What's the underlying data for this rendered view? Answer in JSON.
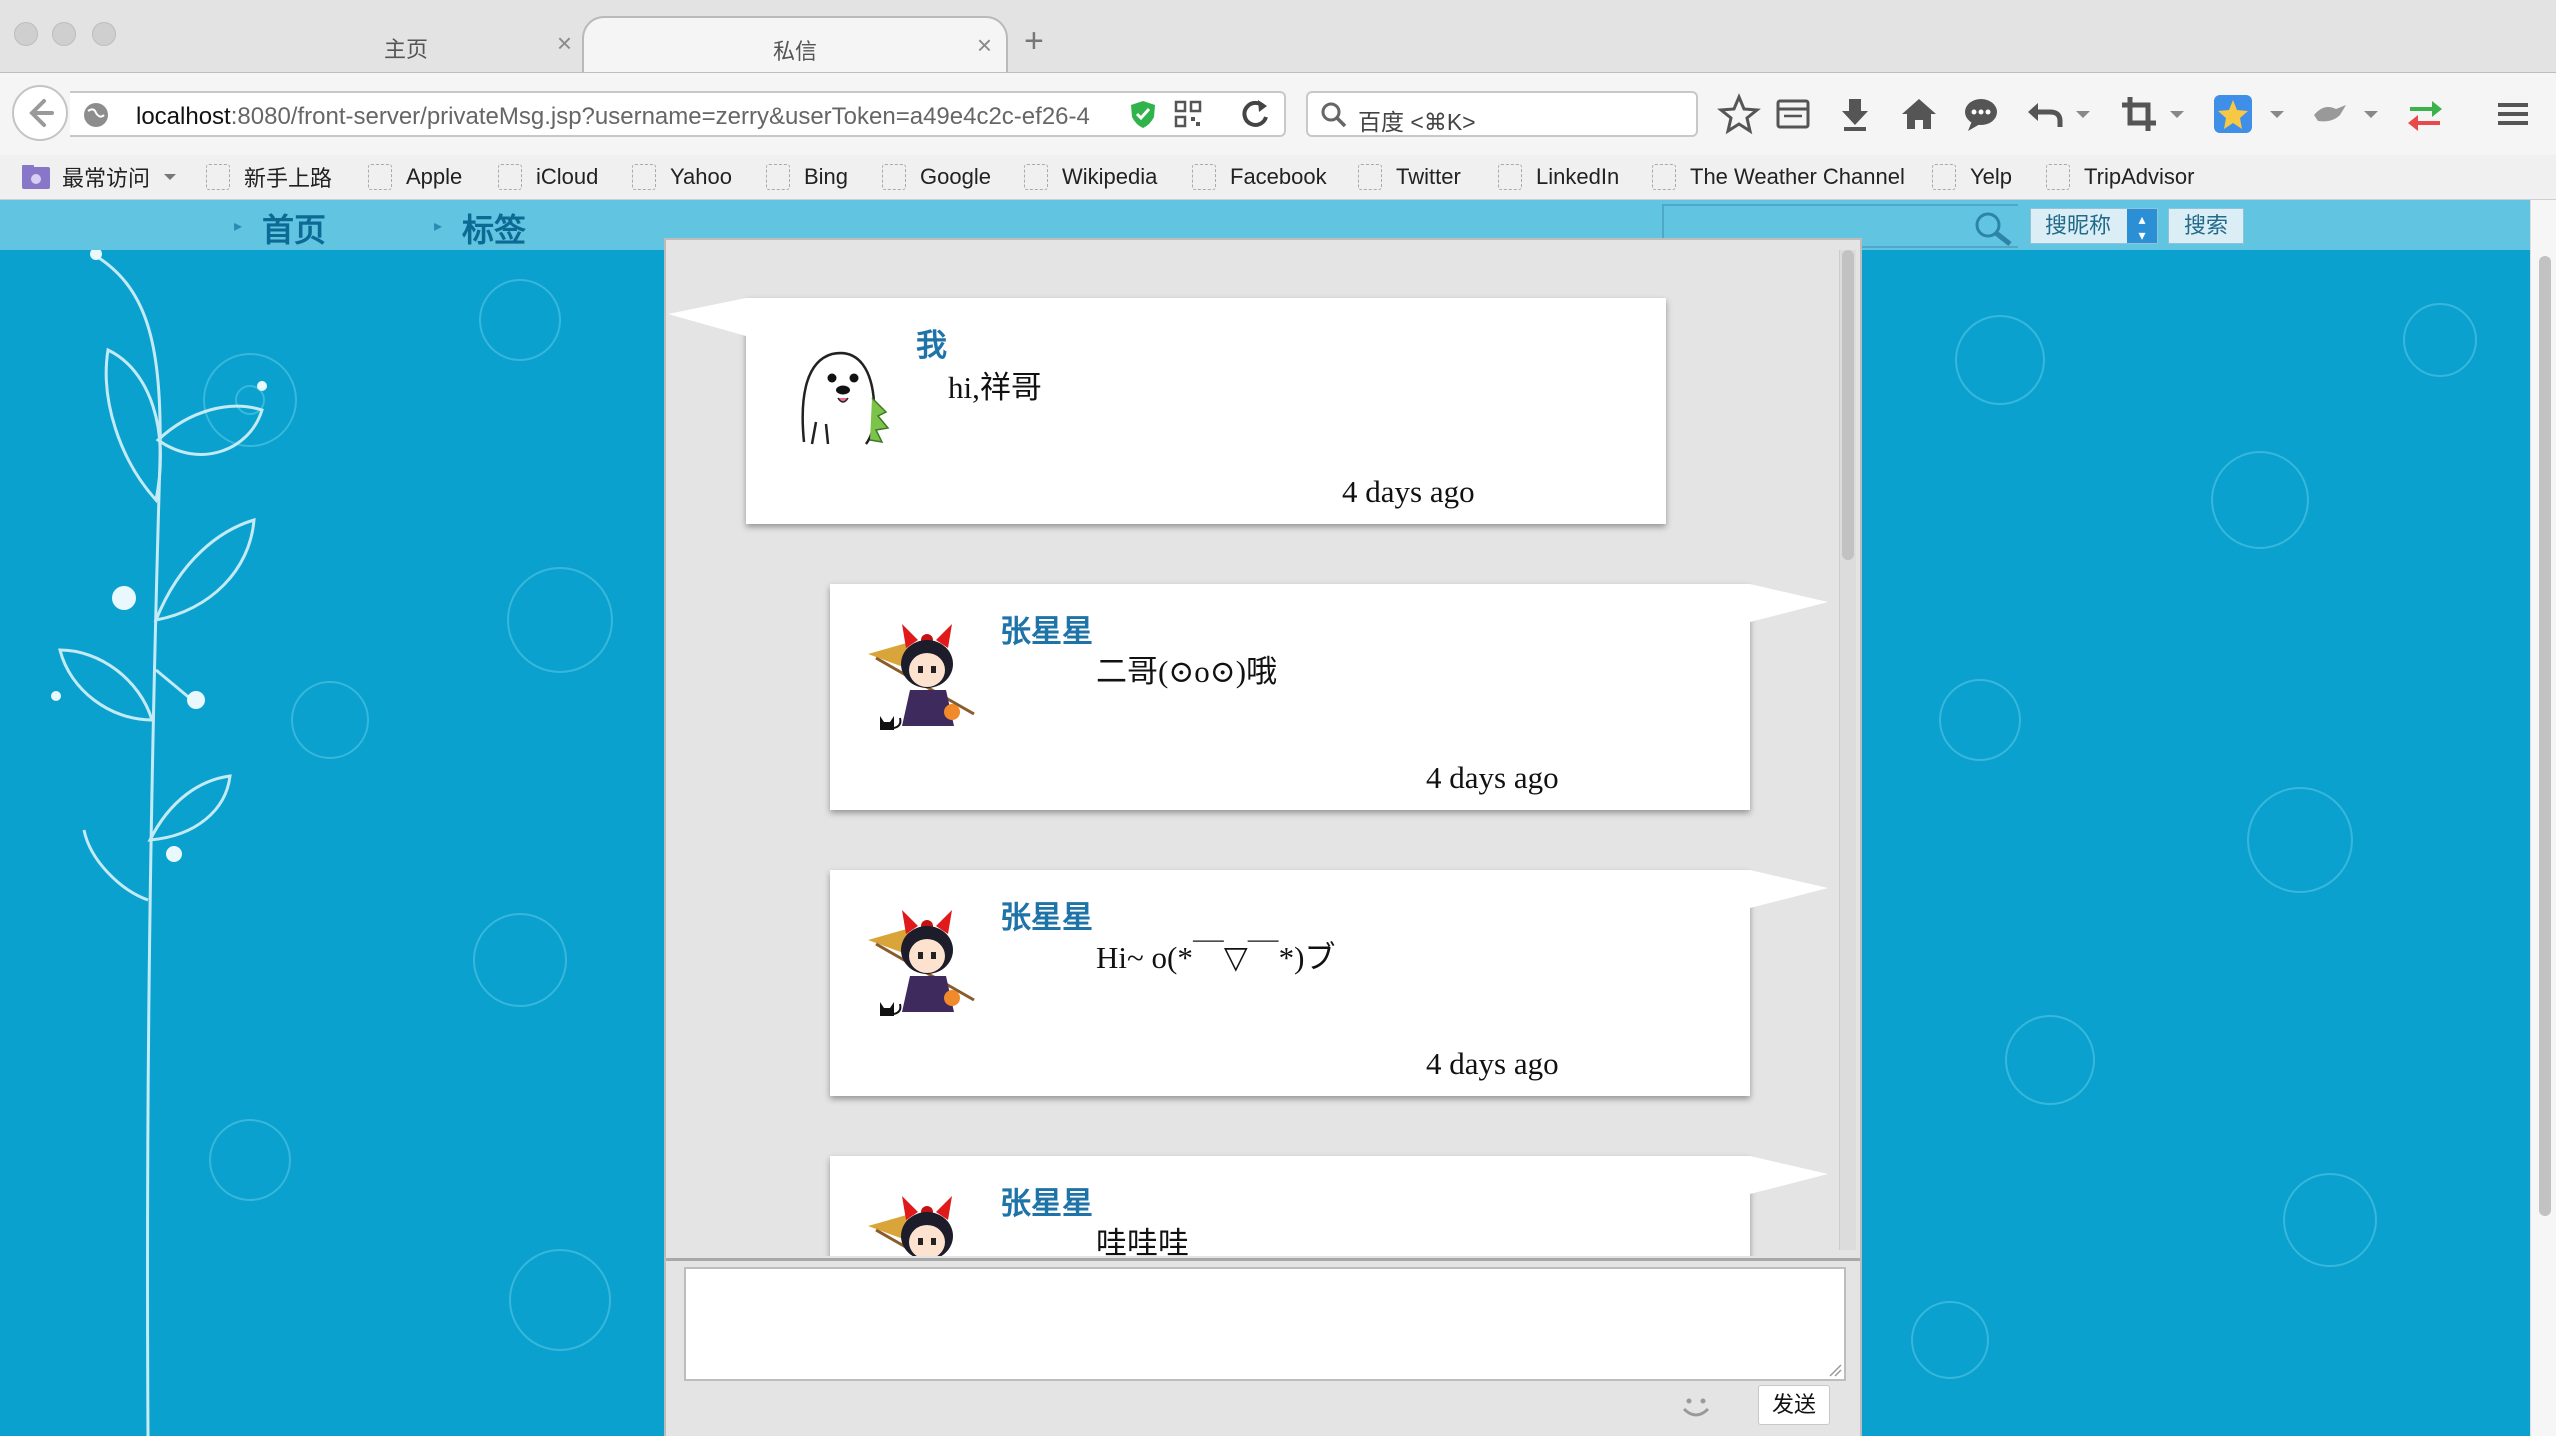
{
  "browser": {
    "tabs": [
      {
        "title": "主页",
        "active": false
      },
      {
        "title": "私信",
        "active": true
      }
    ],
    "new_tab": "+",
    "tab_close": "×",
    "url": {
      "host": "localhost",
      "rest": ":8080/front-server/privateMsg.jsp?username=zerry&userToken=a49e4c2c-ef26-4"
    },
    "search_placeholder": "百度 <⌘K>",
    "bookmarks": {
      "most_visited": "最常访问",
      "items": [
        "新手上路",
        "Apple",
        "iCloud",
        "Yahoo",
        "Bing",
        "Google",
        "Wikipedia",
        "Facebook",
        "Twitter",
        "LinkedIn",
        "The Weather Channel",
        "Yelp",
        "TripAdvisor"
      ]
    }
  },
  "site": {
    "nav": [
      "首页",
      "标签"
    ],
    "search": {
      "select_value": "搜昵称",
      "button": "搜索"
    }
  },
  "chat": {
    "messages": [
      {
        "sender": "我",
        "text": "hi,祥哥",
        "time": "4 days ago",
        "side": "left",
        "avatar": "seal-avatar"
      },
      {
        "sender": "张星星",
        "text": "二哥(⊙o⊙)哦",
        "time": "4 days ago",
        "side": "right",
        "avatar": "witch-girl-avatar"
      },
      {
        "sender": "张星星",
        "text": "Hi~ o(*￣▽￣*)ブ",
        "time": "4 days ago",
        "side": "right",
        "avatar": "witch-girl-avatar"
      },
      {
        "sender": "张星星",
        "text": "哇哇哇",
        "time": "",
        "side": "right",
        "avatar": "witch-girl-avatar"
      }
    ],
    "composer": {
      "send_label": "发送",
      "emoji_icon": "smiley-icon"
    }
  },
  "colors": {
    "page_bg": "#0aa1ce",
    "nav_bg": "#61c4e0",
    "sender_name": "#1e73a8",
    "nav_link": "#0c6a94"
  }
}
